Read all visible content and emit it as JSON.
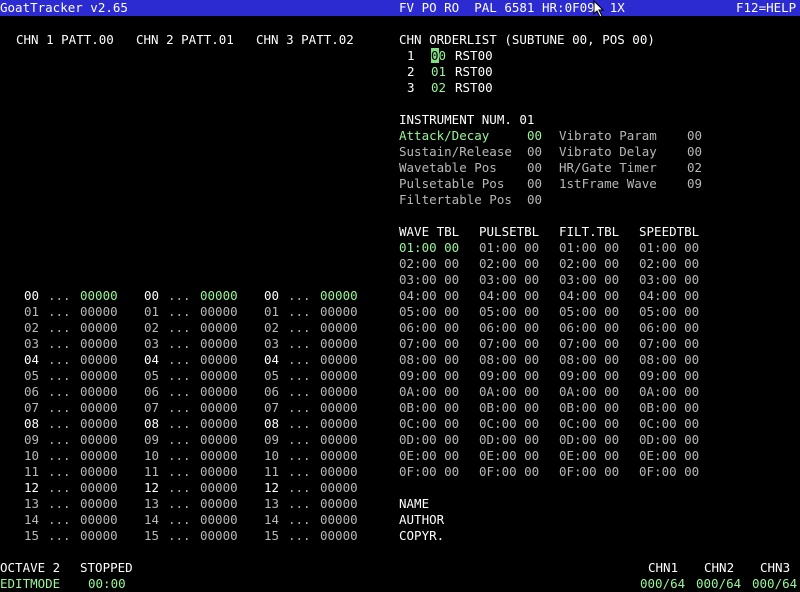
{
  "topbar": {
    "title": "GoatTracker v2.65",
    "status": "FV PO RO  PAL 6581 HR:0F09  1X",
    "help": "F12=HELP"
  },
  "pattern_headers": [
    "CHN 1 PATT.00",
    "CHN 2 PATT.01",
    "CHN 3 PATT.02"
  ],
  "pattern_rows": [
    {
      "n": "00",
      "note": "...",
      "cmd": "00000"
    },
    {
      "n": "01",
      "note": "...",
      "cmd": "00000"
    },
    {
      "n": "02",
      "note": "...",
      "cmd": "00000"
    },
    {
      "n": "03",
      "note": "...",
      "cmd": "00000"
    },
    {
      "n": "04",
      "note": "...",
      "cmd": "00000"
    },
    {
      "n": "05",
      "note": "...",
      "cmd": "00000"
    },
    {
      "n": "06",
      "note": "...",
      "cmd": "00000"
    },
    {
      "n": "07",
      "note": "...",
      "cmd": "00000"
    },
    {
      "n": "08",
      "note": "...",
      "cmd": "00000"
    },
    {
      "n": "09",
      "note": "...",
      "cmd": "00000"
    },
    {
      "n": "10",
      "note": "...",
      "cmd": "00000"
    },
    {
      "n": "11",
      "note": "...",
      "cmd": "00000"
    },
    {
      "n": "12",
      "note": "...",
      "cmd": "00000"
    },
    {
      "n": "13",
      "note": "...",
      "cmd": "00000"
    },
    {
      "n": "14",
      "note": "...",
      "cmd": "00000"
    },
    {
      "n": "15",
      "note": "...",
      "cmd": "00000"
    }
  ],
  "orderlist": {
    "title": "CHN ORDERLIST (SUBTUNE 00, POS 00)",
    "rows": [
      {
        "chn": "1",
        "pos": "00",
        "cmd": "RST00"
      },
      {
        "chn": "2",
        "pos": "01",
        "cmd": "RST00"
      },
      {
        "chn": "3",
        "pos": "02",
        "cmd": "RST00"
      }
    ]
  },
  "instrument": {
    "title": "INSTRUMENT NUM. 01",
    "left": [
      {
        "label": "Attack/Decay",
        "value": "00"
      },
      {
        "label": "Sustain/Release",
        "value": "00"
      },
      {
        "label": "Wavetable Pos",
        "value": "00"
      },
      {
        "label": "Pulsetable Pos",
        "value": "00"
      },
      {
        "label": "Filtertable Pos",
        "value": "00"
      }
    ],
    "right": [
      {
        "label": "Vibrato Param",
        "value": "00"
      },
      {
        "label": "Vibrato Delay",
        "value": "00"
      },
      {
        "label": "HR/Gate Timer",
        "value": "02"
      },
      {
        "label": "1stFrame Wave",
        "value": "09"
      }
    ]
  },
  "tables": {
    "headers": [
      "WAVE TBL",
      "PULSETBL",
      "FILT.TBL",
      "SPEEDTBL"
    ],
    "rows": [
      "01:00 00",
      "02:00 00",
      "03:00 00",
      "04:00 00",
      "05:00 00",
      "06:00 00",
      "07:00 00",
      "08:00 00",
      "09:00 00",
      "0A:00 00",
      "0B:00 00",
      "0C:00 00",
      "0D:00 00",
      "0E:00 00",
      "0F:00 00"
    ]
  },
  "song_info": {
    "name_label": "NAME",
    "author_label": "AUTHOR",
    "copyright_label": "COPYR."
  },
  "status": {
    "octave": "OCTAVE 2",
    "play_state": "STOPPED",
    "mode": "EDITMODE",
    "time": "00:00",
    "channels": [
      {
        "name": "CHN1",
        "pos": "000/64"
      },
      {
        "name": "CHN2",
        "pos": "000/64"
      },
      {
        "name": "CHN3",
        "pos": "000/64"
      }
    ]
  },
  "colors": {
    "topbar_bg": "#2b2bd1",
    "highlight_green": "#9af59a",
    "dim_gray": "#b8b8b8"
  }
}
